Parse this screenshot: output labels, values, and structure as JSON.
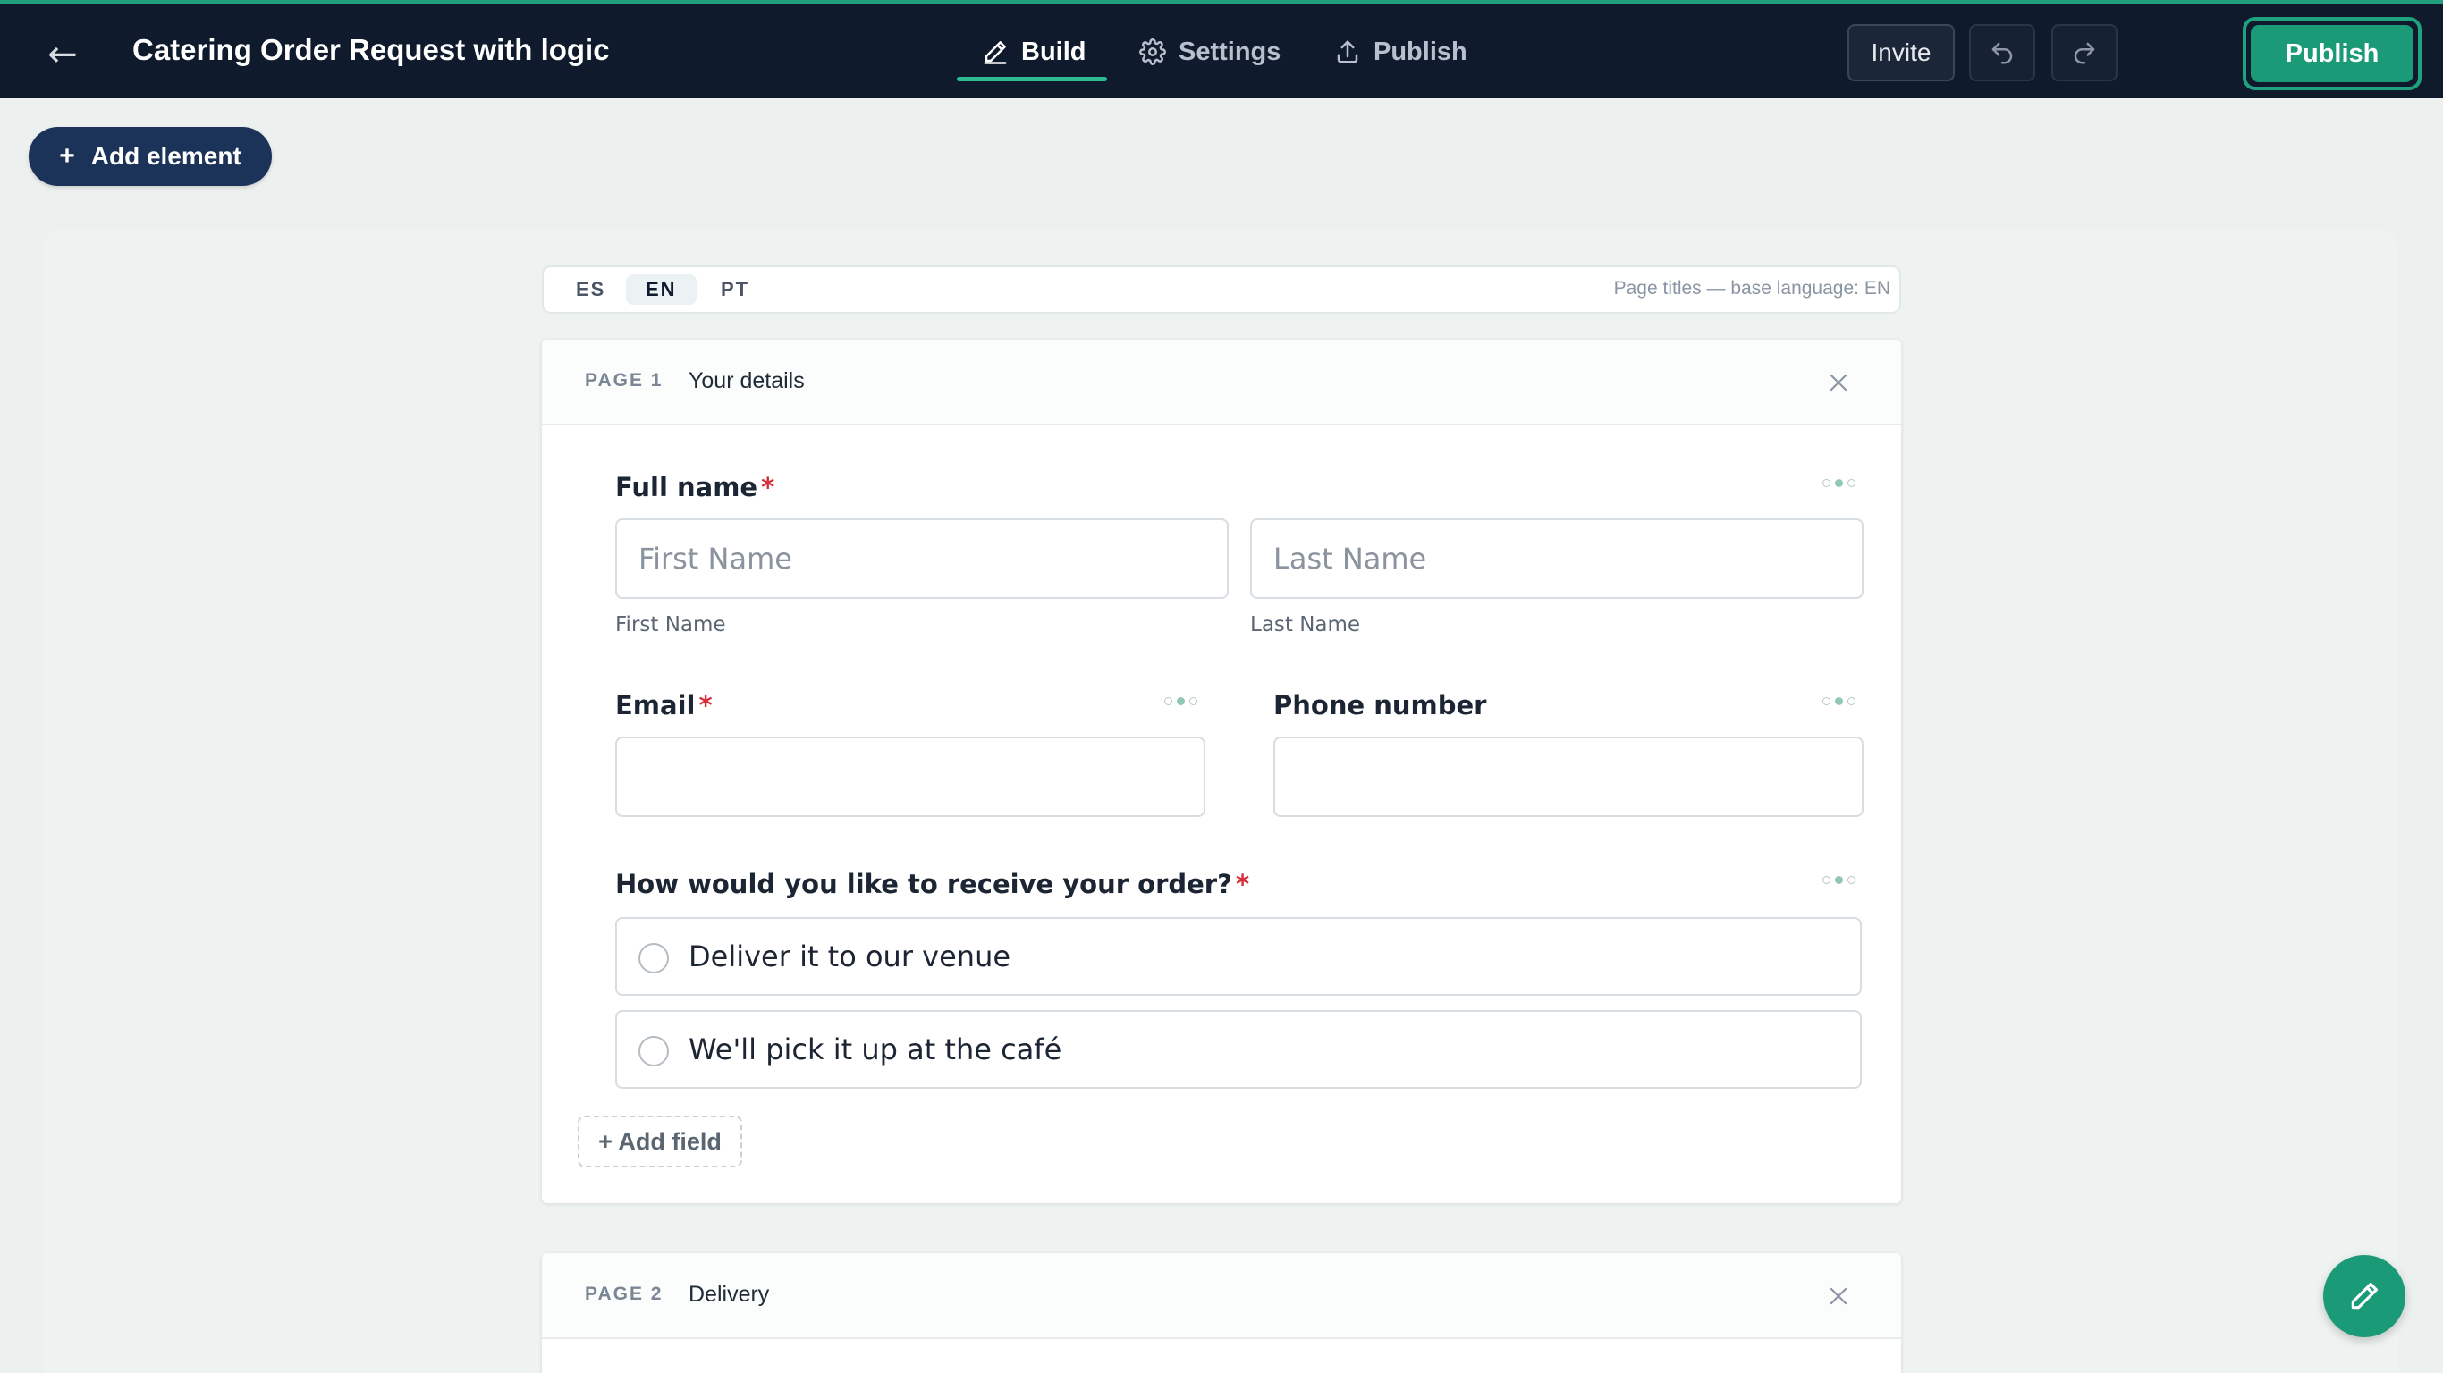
{
  "header": {
    "back_glyph": "←",
    "title": "Catering Order Request with logic",
    "tabs": [
      {
        "label": "Build",
        "icon": "pencil-icon",
        "active": true
      },
      {
        "label": "Settings",
        "icon": "gear-icon",
        "active": false
      },
      {
        "label": "Publish",
        "icon": "upload-icon",
        "active": false
      }
    ],
    "invite_label": "Invite",
    "publish_label": "Publish"
  },
  "toolbar": {
    "add_element_label": "Add element",
    "add_element_glyph": "+"
  },
  "languages": {
    "items": [
      "ES",
      "EN",
      "PT"
    ],
    "selected": "EN",
    "note": "Page titles — base language: EN"
  },
  "pages": [
    {
      "number_label": "PAGE 1",
      "title": "Your details",
      "fields": {
        "full_name": {
          "label": "Full name",
          "required_mark": "*",
          "first_placeholder": "First Name",
          "last_placeholder": "Last Name",
          "first_sublabel": "First Name",
          "last_sublabel": "Last Name"
        },
        "email": {
          "label": "Email",
          "required_mark": "*"
        },
        "phone": {
          "label": "Phone number"
        },
        "receive": {
          "label": "How would you like to receive your order?",
          "required_mark": "*",
          "options": [
            "Deliver it to our venue",
            "We'll pick it up at the café"
          ]
        }
      },
      "add_field_label": "+ Add field"
    },
    {
      "number_label": "PAGE 2",
      "title": "Delivery"
    }
  ],
  "colors": {
    "topbar": "#0f1b2c",
    "accent": "#1b9a78",
    "add_element": "#1b3358",
    "required": "#d62d3a"
  }
}
